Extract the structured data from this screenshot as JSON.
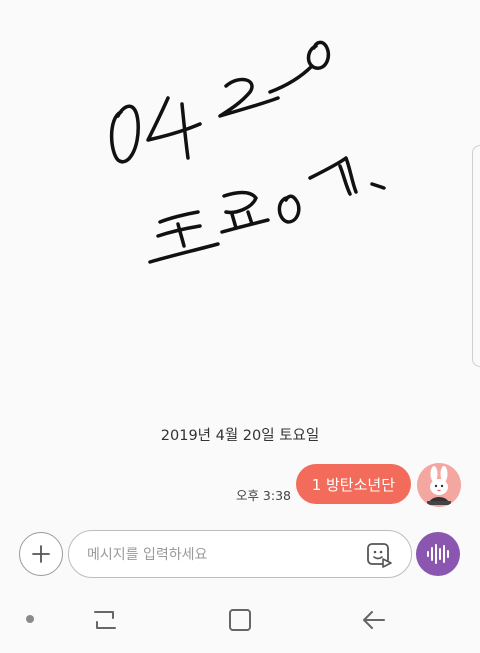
{
  "handwriting": {
    "line1": "0420",
    "line2": "토요일"
  },
  "conversation": {
    "date_separator": "2019년 4월 20일 토요일",
    "messages": [
      {
        "sender": "me",
        "text": "1 방탄소년단",
        "time": "오후 3:38",
        "bubble_color": "#f26b5b"
      }
    ]
  },
  "composer": {
    "placeholder": "메시지를 입력하세요",
    "value": ""
  },
  "icons": {
    "attach": "plus-icon",
    "sticker": "sticker-icon",
    "voice": "voice-wave-icon",
    "avatar": "bunny-avatar-icon"
  },
  "navigation": {
    "items": [
      "dot-icon",
      "recent-apps-icon",
      "home-icon",
      "back-icon"
    ]
  },
  "colors": {
    "background": "#fbfafa",
    "bubble": "#f26b5b",
    "voice_button": "#8b56b0",
    "avatar_bg": "#f4a7a0"
  }
}
